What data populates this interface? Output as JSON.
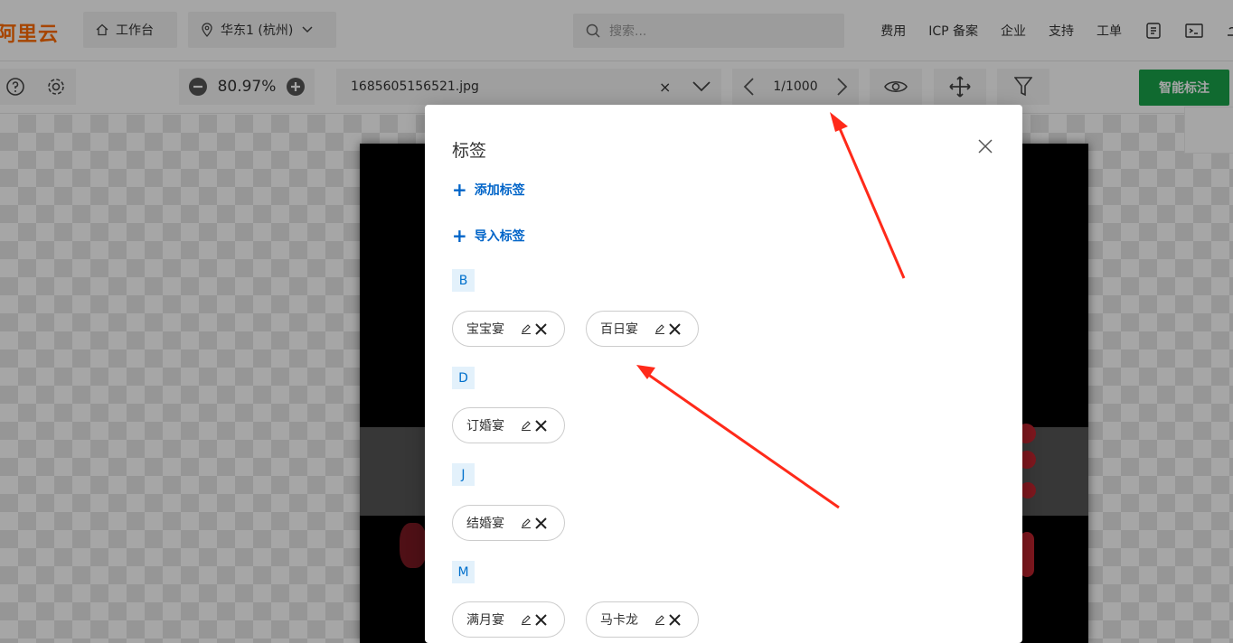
{
  "header": {
    "logo": "阿里云",
    "workbench": "工作台",
    "region": "华东1 (杭州)",
    "search_placeholder": "搜索...",
    "links": [
      "费用",
      "ICP 备案",
      "企业",
      "支持",
      "工单"
    ]
  },
  "toolbar": {
    "zoom": "80.97%",
    "filename": "1685605156521.jpg",
    "clear": "×",
    "page": "1/1000",
    "smart_label_button": "智能标注"
  },
  "modal": {
    "title": "标签",
    "add_tag": "添加标签",
    "import_tag": "导入标签",
    "groups": [
      {
        "letter": "B",
        "tags": [
          "宝宝宴",
          "百日宴"
        ]
      },
      {
        "letter": "D",
        "tags": [
          "订婚宴"
        ]
      },
      {
        "letter": "J",
        "tags": [
          "结婚宴"
        ]
      },
      {
        "letter": "M",
        "tags": [
          "满月宴",
          "马卡龙"
        ]
      }
    ]
  },
  "colors": {
    "brand": "#ff6a00",
    "primary_link": "#0064c8",
    "green_button": "#1aa34a",
    "annotation_arrow": "#ff2a1a"
  }
}
